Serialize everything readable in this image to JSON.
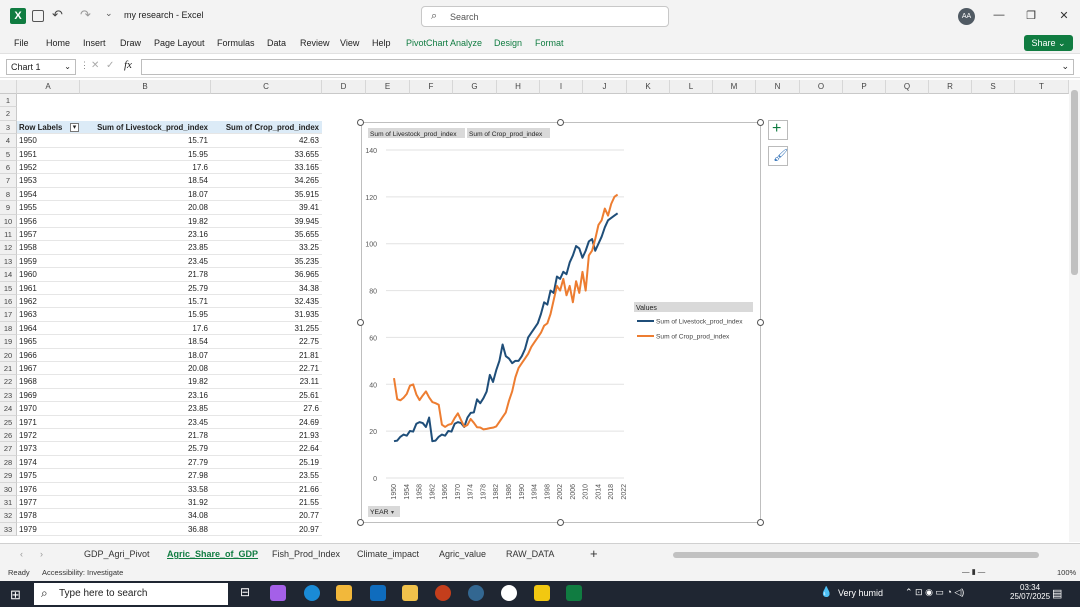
{
  "app": {
    "doc_title": "my research",
    "app_name": "Excel",
    "search_placeholder": "Search",
    "avatar": "AA",
    "share": "Share"
  },
  "ribbon_tabs": [
    "File",
    "Home",
    "Insert",
    "Draw",
    "Page Layout",
    "Formulas",
    "Data",
    "Review",
    "View",
    "Help",
    "PivotChart Analyze",
    "Design",
    "Format"
  ],
  "namebox": "Chart 1",
  "fx": "fx",
  "columns": [
    "A",
    "B",
    "C",
    "D",
    "E",
    "F",
    "G",
    "H",
    "I",
    "J",
    "K",
    "L",
    "M",
    "N",
    "O",
    "P",
    "Q",
    "R",
    "S",
    "T"
  ],
  "table": {
    "headers": [
      "Row Labels",
      "Sum of Livestock_prod_index",
      "Sum of Crop_prod_index"
    ],
    "rows": [
      [
        "1950",
        "15.71",
        "42.63"
      ],
      [
        "1951",
        "15.95",
        "33.655"
      ],
      [
        "1952",
        "17.6",
        "33.165"
      ],
      [
        "1953",
        "18.54",
        "34.265"
      ],
      [
        "1954",
        "18.07",
        "35.915"
      ],
      [
        "1955",
        "20.08",
        "39.41"
      ],
      [
        "1956",
        "19.82",
        "39.945"
      ],
      [
        "1957",
        "23.16",
        "35.655"
      ],
      [
        "1958",
        "23.85",
        "33.25"
      ],
      [
        "1959",
        "23.45",
        "35.235"
      ],
      [
        "1960",
        "21.78",
        "36.965"
      ],
      [
        "1961",
        "25.79",
        "34.38"
      ],
      [
        "1962",
        "15.71",
        "32.435"
      ],
      [
        "1963",
        "15.95",
        "31.935"
      ],
      [
        "1964",
        "17.6",
        "31.255"
      ],
      [
        "1965",
        "18.54",
        "22.75"
      ],
      [
        "1966",
        "18.07",
        "21.81"
      ],
      [
        "1967",
        "20.08",
        "22.71"
      ],
      [
        "1968",
        "19.82",
        "23.11"
      ],
      [
        "1969",
        "23.16",
        "25.61"
      ],
      [
        "1970",
        "23.85",
        "27.6"
      ],
      [
        "1971",
        "23.45",
        "24.69"
      ],
      [
        "1972",
        "21.78",
        "21.93"
      ],
      [
        "1973",
        "25.79",
        "22.64"
      ],
      [
        "1974",
        "27.79",
        "25.19"
      ],
      [
        "1975",
        "27.98",
        "23.55"
      ],
      [
        "1976",
        "33.58",
        "21.66"
      ],
      [
        "1977",
        "31.92",
        "21.55"
      ],
      [
        "1978",
        "34.08",
        "20.77"
      ],
      [
        "1979",
        "36.88",
        "20.97"
      ]
    ]
  },
  "chart_data": {
    "type": "line",
    "field_buttons": [
      "Sum of Livestock_prod_index",
      "Sum of Crop_prod_index"
    ],
    "axis_button": "YEAR",
    "legend_title": "Values",
    "legend_position": "right",
    "ylim": [
      0,
      140
    ],
    "yticks": [
      0,
      20,
      40,
      60,
      80,
      100,
      120,
      140
    ],
    "xticks": [
      "1950",
      "1954",
      "1958",
      "1962",
      "1966",
      "1970",
      "1974",
      "1978",
      "1982",
      "1986",
      "1990",
      "1994",
      "1998",
      "2002",
      "2006",
      "2010",
      "2014",
      "2018",
      "2022"
    ],
    "x_start": 1950,
    "x_end": 2022,
    "series": [
      {
        "name": "Sum of Livestock_prod_index",
        "color": "#1f4e79",
        "values": [
          15.71,
          15.95,
          17.6,
          18.54,
          18.07,
          20.08,
          19.82,
          23.16,
          23.85,
          23.45,
          21.78,
          25.79,
          15.71,
          15.95,
          17.6,
          18.54,
          18.07,
          20.08,
          19.82,
          23.16,
          23.85,
          23.45,
          21.78,
          25.79,
          27.79,
          27.98,
          33.58,
          31.92,
          34.08,
          36.88,
          44,
          41,
          46,
          50,
          57,
          52,
          51,
          49,
          50,
          50,
          52,
          55,
          60,
          62,
          64,
          66,
          70,
          75,
          74,
          80,
          79,
          86,
          85,
          88,
          87,
          92,
          95,
          99,
          98,
          94,
          97,
          101,
          102,
          97,
          100,
          103,
          107,
          110,
          111,
          112,
          113
        ]
      },
      {
        "name": "Sum of Crop_prod_index",
        "color": "#ed7d31",
        "values": [
          42.63,
          33.655,
          33.165,
          34.265,
          35.915,
          39.41,
          39.945,
          35.655,
          33.25,
          35.235,
          36.965,
          34.38,
          32.435,
          31.935,
          31.255,
          22.75,
          21.81,
          22.71,
          23.11,
          25.61,
          27.6,
          24.69,
          21.93,
          22.64,
          25.19,
          23.55,
          21.66,
          21.55,
          20.77,
          20.97,
          21.3,
          21.5,
          22,
          24,
          26,
          28,
          33,
          37,
          43,
          47,
          49,
          51,
          53,
          56,
          58,
          60,
          62,
          65,
          66,
          70,
          76,
          82,
          80,
          85,
          78,
          82,
          75,
          84,
          79,
          88,
          80,
          95,
          97,
          102,
          108,
          110,
          115,
          112,
          117,
          120,
          121
        ]
      }
    ]
  },
  "sheets": [
    "GDP_Agri_Pivot",
    "Agric_Share_of_GDP",
    "Fish_Prod_Index",
    "Climate_impact",
    "Agric_value",
    "RAW_DATA"
  ],
  "active_sheet": "Agric_Share_of_GDP",
  "status": {
    "ready": "Ready",
    "accessibility": "Accessibility: Investigate",
    "zoom": "100%"
  },
  "taskbar": {
    "search": "Type here to search",
    "weather": "Very humid",
    "time": "03:34",
    "date": "25/07/2025"
  }
}
